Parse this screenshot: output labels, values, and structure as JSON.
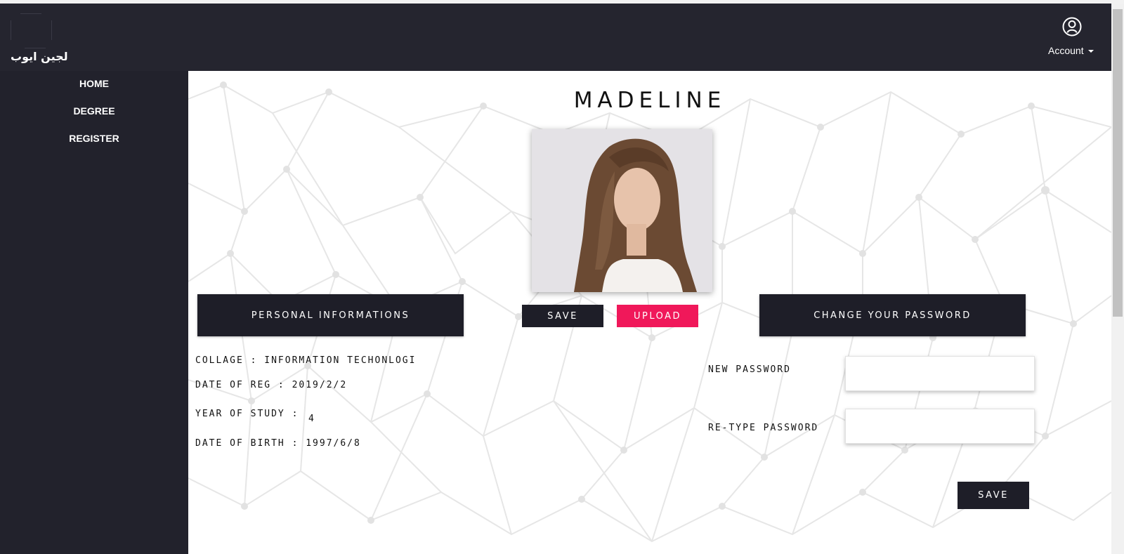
{
  "header": {
    "brand": "لجين ايوب",
    "account_label": "Account",
    "account_icon": "user-circle-icon"
  },
  "sidebar": {
    "items": [
      {
        "label": "HOME"
      },
      {
        "label": "DEGREE"
      },
      {
        "label": "REGISTER"
      }
    ]
  },
  "profile": {
    "name": "MADELINE",
    "photo_alt": "profile-photo",
    "save_label": "SAVE",
    "upload_label": "UPLOAD"
  },
  "personal": {
    "heading": "PERSONAL INFORMATIONS",
    "college": "COLLAGE : INFORMATION TECHONLOGI",
    "date_of_reg": "DATE OF REG : 2019/2/2",
    "year_label": "YEAR OF STUDY :",
    "year_value": "4",
    "date_of_birth": "DATE OF BIRTH : 1997/6/8"
  },
  "password": {
    "heading": "CHANGE YOUR PASSWORD",
    "new_label": "NEW PASSWORD",
    "retype_label": "RE-TYPE PASSWORD",
    "new_value": "",
    "retype_value": "",
    "save_label": "SAVE"
  },
  "colors": {
    "dark": "#1e1e28",
    "accent": "#f0185a"
  }
}
